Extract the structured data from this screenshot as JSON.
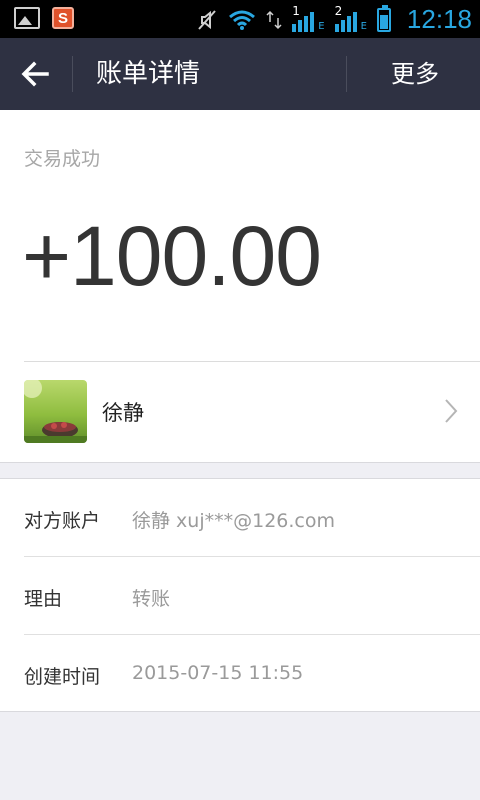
{
  "statusbar": {
    "sim1_label": "1",
    "sim2_label": "2",
    "network_label": "E",
    "app_badge": "S",
    "time": "12:18"
  },
  "navbar": {
    "title": "账单详情",
    "more_label": "更多"
  },
  "transaction": {
    "status": "交易成功",
    "amount": "+100.00"
  },
  "counterparty": {
    "name": "徐静"
  },
  "details": [
    {
      "label": "对方账户",
      "value": "徐静 xuj***@126.com"
    },
    {
      "label": "理由",
      "value": "转账"
    },
    {
      "label": "创建时间",
      "value": "2015-07-15 11:55"
    }
  ],
  "colors": {
    "navbar_bg": "#2e3142",
    "statusbar_accent": "#29a7e1",
    "page_bg": "#efeff4"
  }
}
